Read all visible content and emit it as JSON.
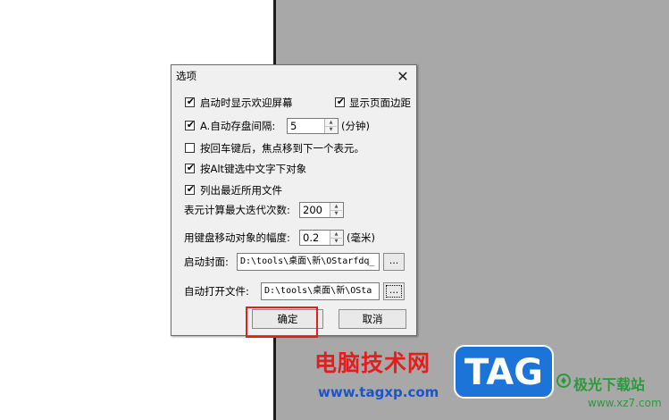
{
  "dialog": {
    "title": "选项",
    "close_glyph": "✕",
    "checkboxes": [
      {
        "label": "启动时显示欢迎屏幕",
        "checked": true
      },
      {
        "label": "显示页面边距",
        "checked": true
      },
      {
        "label": "A.自动存盘间隔:",
        "checked": true
      },
      {
        "label": "按回车键后，焦点移到下一个表元。",
        "checked": false
      },
      {
        "label": "按Alt键选中文字下对象",
        "checked": true
      },
      {
        "label": "列出最近所用文件",
        "checked": true
      }
    ],
    "check_glyph": "✔",
    "autosave": {
      "value": "5",
      "unit": "(分钟)"
    },
    "max_iter": {
      "label": "表元计算最大迭代次数:",
      "value": "200"
    },
    "keyboard_move": {
      "label": "用键盘移动对象的幅度:",
      "value": "0.2",
      "unit": "(毫米)"
    },
    "cover": {
      "label": "启动封面:",
      "value": "D:\\tools\\桌面\\新\\OStarfdq_",
      "browse_label": "..."
    },
    "autoopen": {
      "label": "自动打开文件:",
      "value": "D:\\tools\\桌面\\新\\OSta",
      "browse_label": "..."
    },
    "ok_label": "确定",
    "cancel_label": "取消"
  },
  "annotation": {
    "highlight_color": "#e0201b"
  },
  "watermark": {
    "site_name": "电脑技术网",
    "site_url": "www.tagxp.com",
    "badge_text": "TAG",
    "partner_name": "极光下载站",
    "partner_url": "www.xz7.com"
  },
  "colors": {
    "dialog_bg": "#f0f0f0",
    "right_pane_bg": "#a8a8a8",
    "watermark_red": "#e41e1e",
    "watermark_blue": "#1d54c7",
    "badge_blue": "#1c74d9",
    "partner_green": "#2b9a3c"
  }
}
